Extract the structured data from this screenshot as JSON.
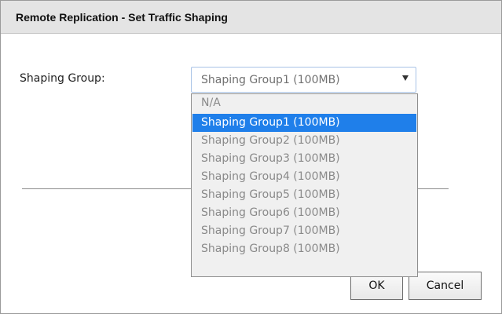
{
  "dialog": {
    "title": "Remote Replication - Set Traffic Shaping"
  },
  "form": {
    "shaping_group_label": "Shaping Group:",
    "shaping_group_value": "Shaping Group1 (100MB)"
  },
  "dropdown": {
    "options": [
      "N/A",
      "Shaping Group1 (100MB)",
      "Shaping Group2 (100MB)",
      "Shaping Group3 (100MB)",
      "Shaping Group4 (100MB)",
      "Shaping Group5 (100MB)",
      "Shaping Group6 (100MB)",
      "Shaping Group7 (100MB)",
      "Shaping Group8 (100MB)"
    ],
    "selected_index": 1
  },
  "buttons": {
    "ok_label": "OK",
    "cancel_label": "Cancel"
  },
  "colors": {
    "selection": "#1f7fea",
    "titlebar": "#e4e4e4"
  }
}
